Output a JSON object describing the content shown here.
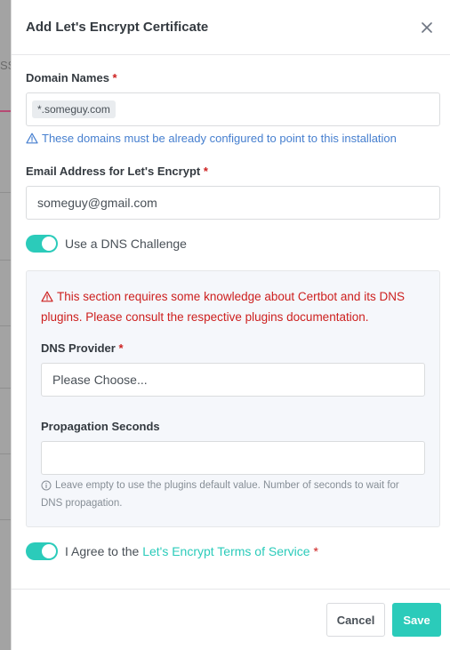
{
  "background": {
    "fragment_text": "SSI"
  },
  "modal": {
    "title": "Add Let's Encrypt Certificate",
    "close_icon": "close-icon"
  },
  "domain_names": {
    "label": "Domain Names",
    "required_mark": "*",
    "tags": [
      "*.someguy.com"
    ],
    "hint": "These domains must be already configured to point to this installation"
  },
  "email": {
    "label": "Email Address for Let's Encrypt",
    "required_mark": "*",
    "value": "someguy@gmail.com"
  },
  "dns_challenge": {
    "label": "Use a DNS Challenge",
    "enabled": true
  },
  "dns_section": {
    "warning_line1": "This section requires some knowledge about Certbot and its DNS",
    "warning_line2": "plugins. Please consult the respective plugins documentation.",
    "provider_label": "DNS Provider",
    "provider_required": "*",
    "provider_value": "Please Choose...",
    "propagation_label": "Propagation Seconds",
    "propagation_value": "",
    "propagation_hint_line1": "Leave empty to use the plugins default value. Number of seconds to wait for",
    "propagation_hint_line2": "DNS propagation."
  },
  "agree": {
    "prefix": "I Agree to the",
    "link": "Let's Encrypt Terms of Service",
    "required_mark": "*",
    "enabled": true
  },
  "footer": {
    "cancel_label": "Cancel",
    "save_label": "Save"
  },
  "colors": {
    "accent": "#2bcbba",
    "danger": "#cd201f",
    "info": "#467fcf"
  }
}
